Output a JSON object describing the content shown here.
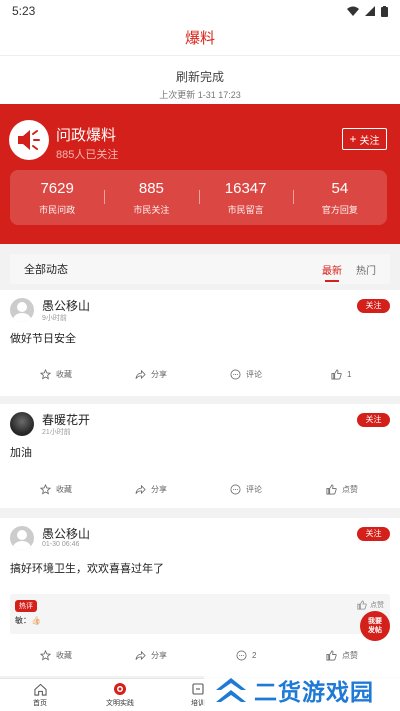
{
  "status_bar": {
    "time": "5:23"
  },
  "header": {
    "title": "爆料"
  },
  "refresh": {
    "status": "刷新完成",
    "last_update": "上次更新 1-31 17:23"
  },
  "channel": {
    "name": "问政爆料",
    "followers": "885人已关注",
    "follow_label": "关注",
    "stats": [
      {
        "value": "7629",
        "label": "市民问政"
      },
      {
        "value": "885",
        "label": "市民关注"
      },
      {
        "value": "16347",
        "label": "市民留言"
      },
      {
        "value": "54",
        "label": "官方回复"
      }
    ]
  },
  "feed": {
    "title": "全部动态",
    "tabs": [
      {
        "label": "最新"
      },
      {
        "label": "热门"
      }
    ],
    "posts": [
      {
        "author": "愚公移山",
        "time": "9小时前",
        "follow_label": "关注",
        "text": "做好节日安全",
        "actions": {
          "collect": "收藏",
          "share": "分享",
          "comment": "评论",
          "like": "1"
        }
      },
      {
        "author": "春暖花开",
        "time": "21小时前",
        "follow_label": "关注",
        "text": "加油",
        "actions": {
          "collect": "收藏",
          "share": "分享",
          "comment": "评论",
          "like": "点赞"
        }
      },
      {
        "author": "愚公移山",
        "time": "01-30 06:46",
        "follow_label": "关注",
        "text": "搞好环境卫生，欢欢喜喜过年了",
        "hot_comment": {
          "badge": "热评",
          "text": "敏：👍🏻",
          "like": "点赞"
        },
        "actions": {
          "collect": "收藏",
          "share": "分享",
          "comment": "2",
          "like": "点赞"
        }
      }
    ]
  },
  "fab": {
    "line1": "我要",
    "line2": "发帖"
  },
  "bottom_nav": {
    "items": [
      {
        "label": "首页"
      },
      {
        "label": "文明实践"
      },
      {
        "label": "培训"
      }
    ]
  },
  "watermark": {
    "text": "二货游戏园"
  },
  "colors": {
    "accent": "#d4201a",
    "watermark": "#1f7ad6"
  }
}
